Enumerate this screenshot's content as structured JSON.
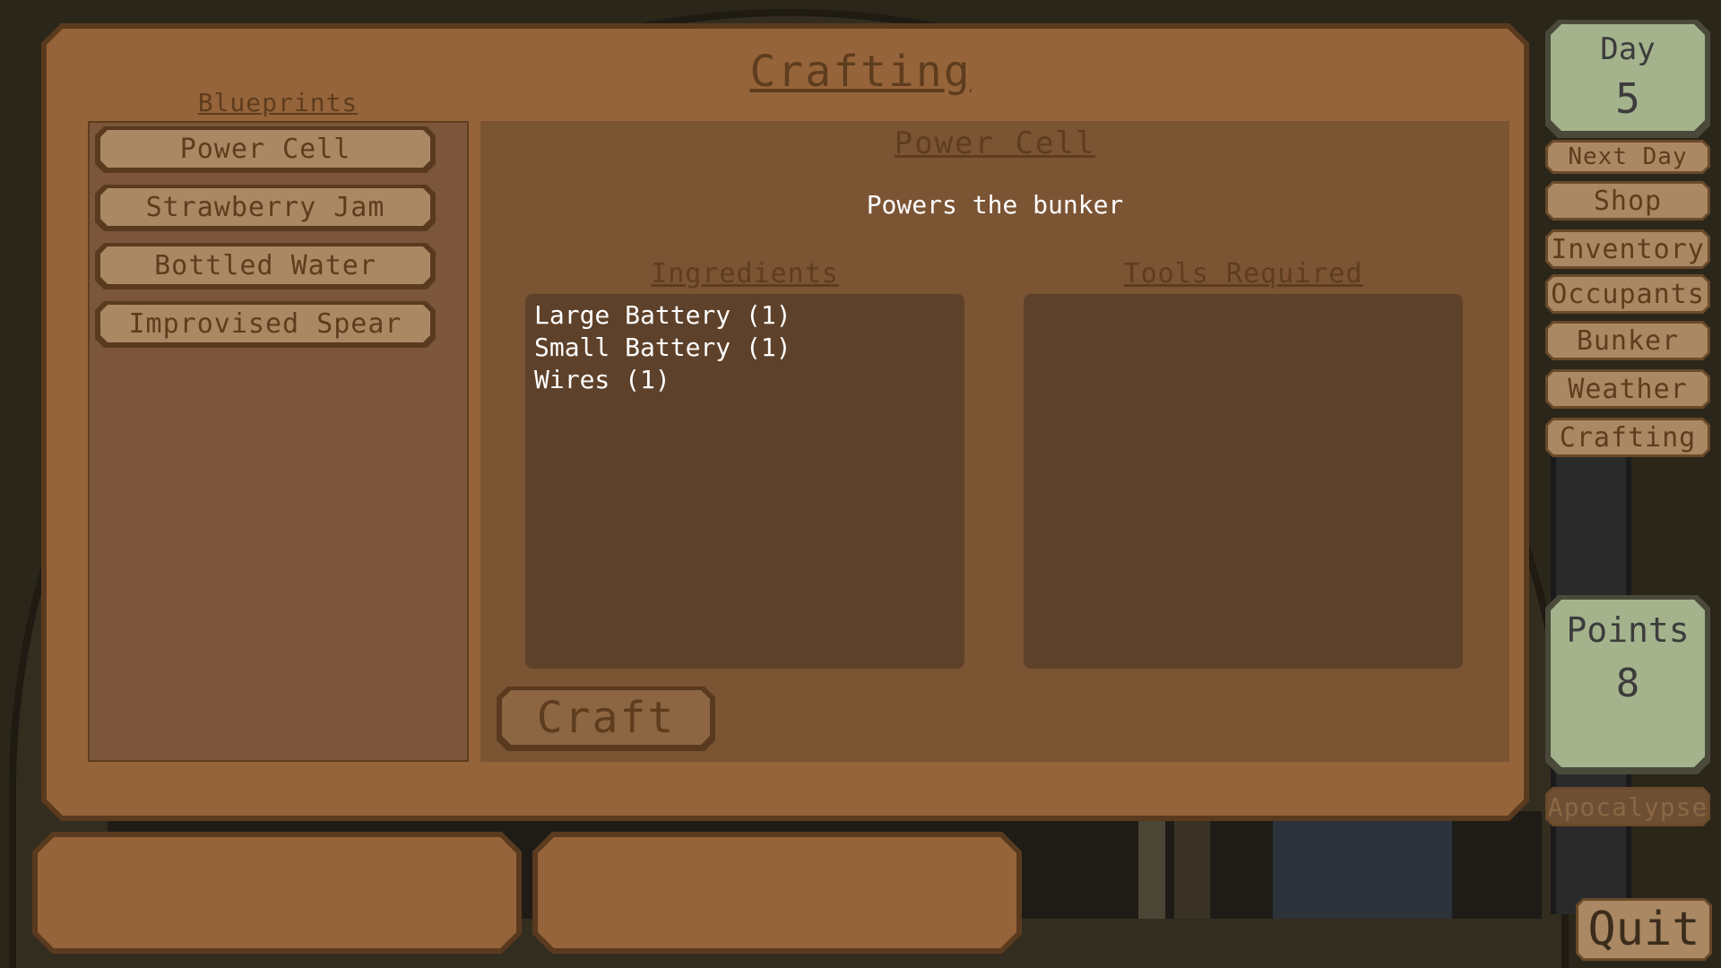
{
  "window": {
    "title": "Crafting"
  },
  "blueprints": {
    "heading": "Blueprints",
    "items": [
      {
        "label": "Power Cell"
      },
      {
        "label": "Strawberry Jam"
      },
      {
        "label": "Bottled Water"
      },
      {
        "label": "Improvised Spear"
      }
    ]
  },
  "detail": {
    "name": "Power Cell",
    "description": "Powers the bunker",
    "ingredients_heading": "Ingredients",
    "tools_heading": "Tools Required",
    "ingredients": [
      "Large Battery (1)",
      "Small Battery (1)",
      "Wires (1)"
    ],
    "tools": [],
    "craft_label": "Craft"
  },
  "sidebar": {
    "day_label": "Day",
    "day_value": "5",
    "points_label": "Points",
    "points_value": "8",
    "nav": {
      "next_day": "Next Day",
      "shop": "Shop",
      "inventory": "Inventory",
      "occupants": "Occupants",
      "bunker": "Bunker",
      "weather": "Weather",
      "crafting": "Crafting",
      "apocalypse": "Apocalypse"
    },
    "quit": "Quit"
  },
  "colors": {
    "panel": "#96643a",
    "panel_dark": "#5a3a1e",
    "button": "#a98863",
    "text_brown": "#5e3d1e",
    "card_green": "#a4b38c"
  }
}
